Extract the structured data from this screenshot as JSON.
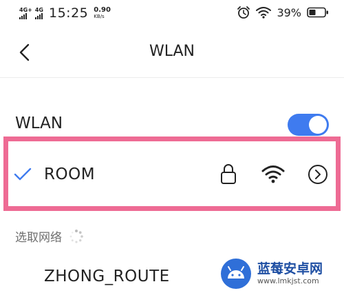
{
  "status_bar": {
    "network_tag_1": "4G+",
    "network_tag_2": "4G",
    "time": "15:25",
    "speed_value": "0.90",
    "speed_unit": "KB/s",
    "battery_percent": "39%"
  },
  "header": {
    "title": "WLAN",
    "back_icon": "chevron-left-icon"
  },
  "wlan_toggle": {
    "label": "WLAN",
    "enabled": true,
    "color": "#3f7bef"
  },
  "connected_network": {
    "name": "ROOM",
    "connected": true,
    "secured": true,
    "icons": [
      "check-icon",
      "lock-icon",
      "wifi-icon",
      "chevron-right-circle-icon"
    ]
  },
  "networks_section": {
    "label": "选取网络",
    "scanning": true
  },
  "available_networks": [
    {
      "name": "ZHONG_ROUTE"
    }
  ],
  "watermark": {
    "name": "蓝莓安卓网",
    "url": "www.lmkjst.com"
  },
  "colors": {
    "accent": "#3f7bef",
    "highlight": "#ee6b94"
  }
}
